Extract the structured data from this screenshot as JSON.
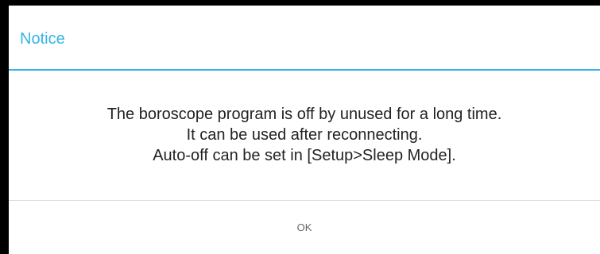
{
  "dialog": {
    "title": "Notice",
    "message_lines": [
      "The boroscope program is off by unused for a long time.",
      "It can be used after reconnecting.",
      "Auto-off can be set in [Setup>Sleep Mode]."
    ],
    "ok_label": "OK"
  },
  "colors": {
    "accent": "#35b4e6",
    "background": "#000000",
    "dialog_background": "#ffffff"
  }
}
